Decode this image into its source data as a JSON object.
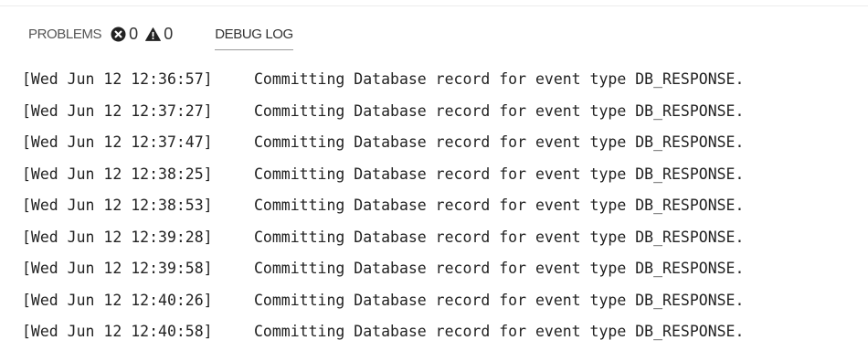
{
  "panel": {
    "tabs": {
      "problems": {
        "label": "PROBLEMS",
        "error_count": "0",
        "warning_count": "0",
        "error_icon": "error-circle-icon",
        "warning_icon": "warning-triangle-icon"
      },
      "debug_log": {
        "label": "DEBUG LOG",
        "active": true
      }
    }
  },
  "log": {
    "lines": [
      {
        "timestamp": "[Wed Jun 12 12:36:57]",
        "message": "Committing Database record for event type DB_RESPONSE."
      },
      {
        "timestamp": "[Wed Jun 12 12:37:27]",
        "message": "Committing Database record for event type DB_RESPONSE."
      },
      {
        "timestamp": "[Wed Jun 12 12:37:47]",
        "message": "Committing Database record for event type DB_RESPONSE."
      },
      {
        "timestamp": "[Wed Jun 12 12:38:25]",
        "message": "Committing Database record for event type DB_RESPONSE."
      },
      {
        "timestamp": "[Wed Jun 12 12:38:53]",
        "message": "Committing Database record for event type DB_RESPONSE."
      },
      {
        "timestamp": "[Wed Jun 12 12:39:28]",
        "message": "Committing Database record for event type DB_RESPONSE."
      },
      {
        "timestamp": "[Wed Jun 12 12:39:58]",
        "message": "Committing Database record for event type DB_RESPONSE."
      },
      {
        "timestamp": "[Wed Jun 12 12:40:26]",
        "message": "Committing Database record for event type DB_RESPONSE."
      },
      {
        "timestamp": "[Wed Jun 12 12:40:58]",
        "message": "Committing Database record for event type DB_RESPONSE."
      }
    ]
  },
  "colors": {
    "text": "#222222",
    "tab_inactive": "#555555",
    "icon": "#222222"
  }
}
